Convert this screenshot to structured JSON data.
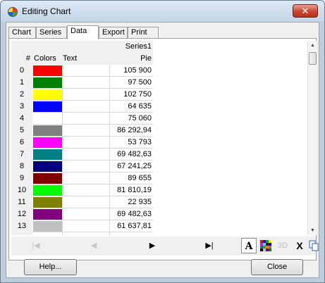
{
  "window": {
    "title": "Editing Chart",
    "close_label": "✕"
  },
  "tabs": [
    "Chart",
    "Series",
    "Data",
    "Export",
    "Print"
  ],
  "active_tab": "Data",
  "grid": {
    "series_name": "Series1",
    "series_type": "Pie",
    "header_index": "#",
    "header_colors": "Colors",
    "header_text": "Text",
    "rows": [
      {
        "idx": "0",
        "color": "#ff0000",
        "text": "",
        "value": "105 900"
      },
      {
        "idx": "1",
        "color": "#008000",
        "text": "",
        "value": "97 500"
      },
      {
        "idx": "2",
        "color": "#ffff00",
        "text": "",
        "value": "102 750"
      },
      {
        "idx": "3",
        "color": "#0000ff",
        "text": "",
        "value": "64 635"
      },
      {
        "idx": "4",
        "color": "#ffffff",
        "text": "",
        "value": "75 060"
      },
      {
        "idx": "5",
        "color": "#808080",
        "text": "",
        "value": "86 292,94"
      },
      {
        "idx": "6",
        "color": "#ff00ff",
        "text": "",
        "value": "53 793"
      },
      {
        "idx": "7",
        "color": "#008080",
        "text": "",
        "value": "69 482,63"
      },
      {
        "idx": "8",
        "color": "#000080",
        "text": "",
        "value": "67 241,25"
      },
      {
        "idx": "9",
        "color": "#800000",
        "text": "",
        "value": "89 655"
      },
      {
        "idx": "10",
        "color": "#00ff00",
        "text": "",
        "value": "81 810,19"
      },
      {
        "idx": "11",
        "color": "#808000",
        "text": "",
        "value": "22 935"
      },
      {
        "idx": "12",
        "color": "#800080",
        "text": "",
        "value": "69 482,63"
      },
      {
        "idx": "13",
        "color": "#c0c0c0",
        "text": "",
        "value": "61 637,81"
      }
    ]
  },
  "nav": {
    "first": "|◀",
    "prev": "◀",
    "next": "▶",
    "last": "▶|"
  },
  "toolbar": {
    "font_label": "A",
    "threed_label": "3D",
    "delete_label": "X"
  },
  "buttons": {
    "help": "Help...",
    "close": "Close"
  }
}
